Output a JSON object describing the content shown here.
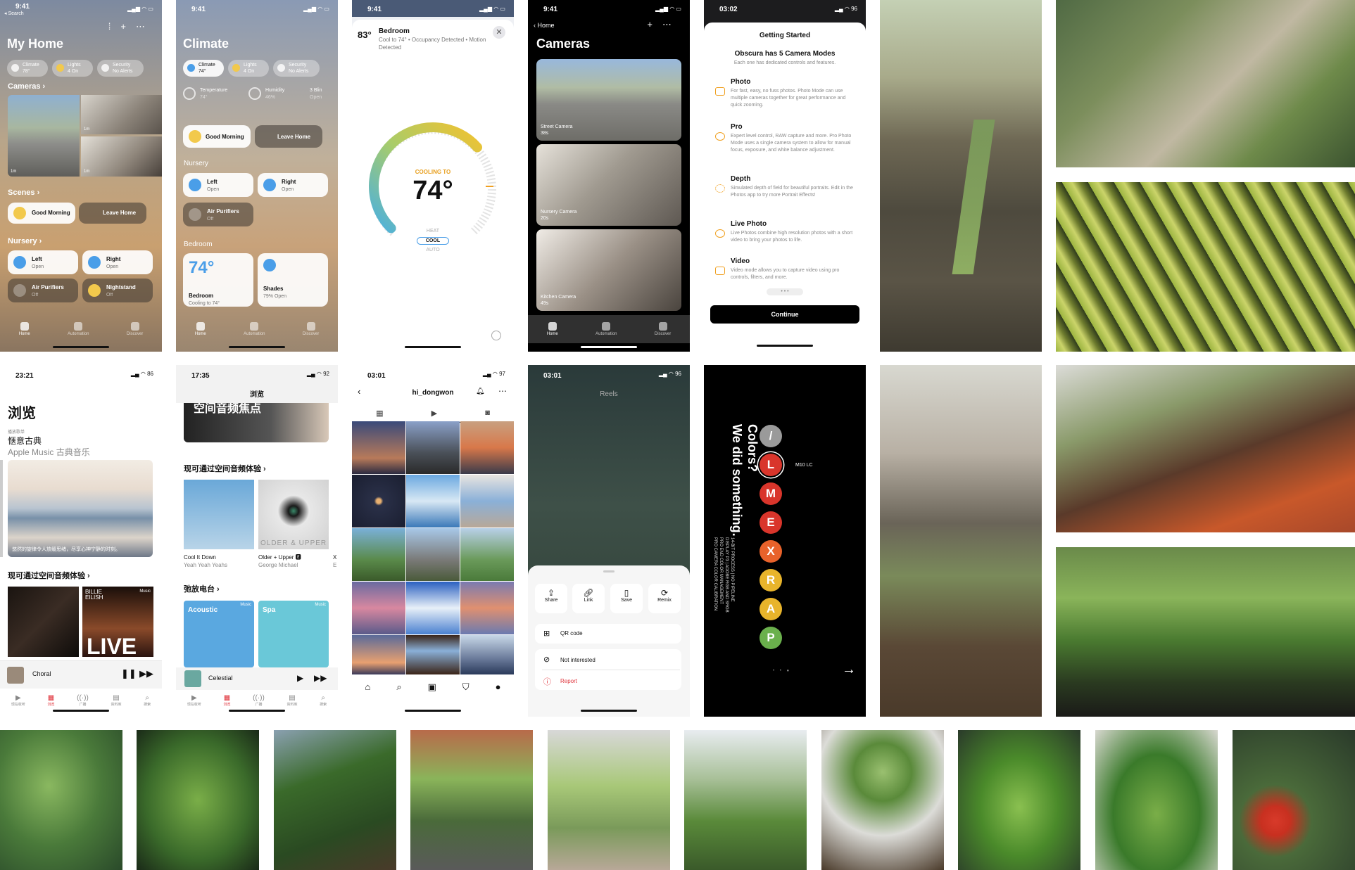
{
  "screen1": {
    "time": "9:41",
    "back": "◂ Search",
    "title": "My Home",
    "pills": [
      {
        "label": "Climate",
        "sub": "78°"
      },
      {
        "label": "Lights",
        "sub": "4 On"
      },
      {
        "label": "Security",
        "sub": "No Alerts"
      }
    ],
    "cameras_label": "Cameras",
    "cam_tags": [
      "1m",
      "1m",
      "1m"
    ],
    "scenes_label": "Scenes",
    "scenes": [
      "Good Morning",
      "Leave Home"
    ],
    "nursery_label": "Nursery",
    "cards": [
      {
        "title": "Left",
        "sub": "Open"
      },
      {
        "title": "Right",
        "sub": "Open"
      },
      {
        "title": "Air Purifiers",
        "sub": "Off"
      },
      {
        "title": "Nightstand",
        "sub": "Off"
      }
    ],
    "tabs": [
      "Home",
      "Automation",
      "Discover"
    ]
  },
  "screen2": {
    "time": "9:41",
    "title": "Climate",
    "pills": [
      {
        "label": "Climate",
        "sub": "74°"
      },
      {
        "label": "Lights",
        "sub": "4 On"
      },
      {
        "label": "Security",
        "sub": "No Alerts"
      }
    ],
    "sensors": [
      {
        "label": "Temperature",
        "sub": "74°"
      },
      {
        "label": "Humidity",
        "sub": "46%"
      },
      {
        "label": "3 Blin",
        "sub": "Open"
      }
    ],
    "scenes": [
      "Good Morning",
      "Leave Home"
    ],
    "nursery_label": "Nursery",
    "cards": [
      {
        "title": "Left",
        "sub": "Open"
      },
      {
        "title": "Right",
        "sub": "Open"
      },
      {
        "title": "Air Purifiers",
        "sub": "Off"
      }
    ],
    "bedroom_label": "Bedroom",
    "bedroom_temp": "74°",
    "bedroom_cards": [
      {
        "title": "Bedroom",
        "sub": "Cooling to 74°"
      },
      {
        "title": "Shades",
        "sub": "79% Open"
      }
    ],
    "tabs": [
      "Home",
      "Automation",
      "Discover"
    ]
  },
  "screen3": {
    "time": "9:41",
    "current_temp": "83°",
    "room": "Bedroom",
    "desc": "Cool to 74° • Occupancy Detected • Motion Detected",
    "cooling_to": "COOLING TO",
    "target": "74°",
    "modes": [
      "HEAT",
      "COOL",
      "AUTO"
    ],
    "gauge_fraction": 0.68
  },
  "screen4": {
    "time": "9:41",
    "back": "Home",
    "title": "Cameras",
    "cams": [
      {
        "name": "Street Camera",
        "sub": "38s"
      },
      {
        "name": "Nursery Camera",
        "sub": "20s"
      },
      {
        "name": "Kitchen Camera",
        "sub": "49s"
      }
    ],
    "tabs": [
      "Home",
      "Automation",
      "Discover"
    ]
  },
  "screen5": {
    "time": "03:02",
    "battery": "96",
    "header": "Getting Started",
    "title": "Obscura has 5 Camera Modes",
    "subtitle": "Each one has dedicated controls and features.",
    "modes": [
      {
        "name": "Photo",
        "desc": "For fast, easy, no fuss photos. Photo Mode can use multiple cameras together for great performance and quick zooming."
      },
      {
        "name": "Pro",
        "desc": "Expert level control, RAW capture and more. Pro Photo Mode uses a single camera system to allow for manual focus, exposure, and white balance adjustment."
      },
      {
        "name": "Depth",
        "desc": "Simulated depth of field for beautiful portraits. Edit in the Photos app to try more Portrait Effects!"
      },
      {
        "name": "Live Photo",
        "desc": "Live Photos combine high resolution photos with a short video to bring your photos to life."
      },
      {
        "name": "Video",
        "desc": "Video mode allows you to capture video using pro controls, filters, and more."
      }
    ],
    "continue": "Continue"
  },
  "screen6": {
    "time": "23:21",
    "battery": "86",
    "title": "浏览",
    "eyebrow": "播放歌单",
    "playlist": "惬意古典",
    "playlist_sub": "Apple Music 古典音乐",
    "caption": "悠然的旋律令人放缓思绪，尽享心神宁静的时刻。",
    "section": "现可通过空间音频体验",
    "live": "LIVE",
    "billie": "BILLIE EILISH",
    "applemusic": "Music",
    "now_playing": "Choral",
    "tabs": [
      "现在收听",
      "浏览",
      "广播",
      "资料库",
      "搜索"
    ]
  },
  "screen7": {
    "time": "17:35",
    "battery": "92",
    "title": "浏览",
    "banner": "空间音频焦点",
    "section1": "现可通过空间音频体验",
    "albums": [
      {
        "title": "Cool It Down",
        "artist": "Yeah Yeah Yeahs"
      },
      {
        "title": "Older + Upper 🅴",
        "artist": "George Michael"
      },
      {
        "title": "X",
        "artist": "E"
      }
    ],
    "album_art_text": "OLDER & UPPER",
    "section2": "弛放电台",
    "stations": [
      "Acoustic",
      "Spa"
    ],
    "applemusic": "Music",
    "now_playing": "Celestial",
    "tabs": [
      "现在收听",
      "浏览",
      "广播",
      "资料库",
      "搜索"
    ]
  },
  "screen8": {
    "time": "03:01",
    "battery": "97",
    "username": "hi_dongwon"
  },
  "screen9": {
    "time": "03:01",
    "battery": "96",
    "header": "Reels",
    "actions": [
      "Share",
      "Link",
      "Save",
      "Remix"
    ],
    "menu": [
      {
        "label": "QR code"
      },
      {
        "label": "Not interested"
      },
      {
        "label": "Report",
        "color": "#e0353d"
      }
    ]
  },
  "screen10": {
    "title1": "Colors?",
    "title2": "We did something.",
    "desc1": "14-BIT PROCESS | NO PIPELINE",
    "desc2": "DISPLAY P3 | ADOBE RGB AND SRGB",
    "desc3": "PRO END COLOR MANAGEMENT",
    "desc4": "PRO CAMERA COLOR CALIBRATION",
    "model": "M10 LC",
    "circles": [
      {
        "label": "/",
        "color": "#9a9a9a"
      },
      {
        "label": "L",
        "color": "#d9352b"
      },
      {
        "label": "M",
        "color": "#d9352b"
      },
      {
        "label": "E",
        "color": "#d9352b"
      },
      {
        "label": "X",
        "color": "#e8622b"
      },
      {
        "label": "R",
        "color": "#e8b42b"
      },
      {
        "label": "A",
        "color": "#e8b42b"
      },
      {
        "label": "P",
        "color": "#6ab04c"
      }
    ]
  }
}
